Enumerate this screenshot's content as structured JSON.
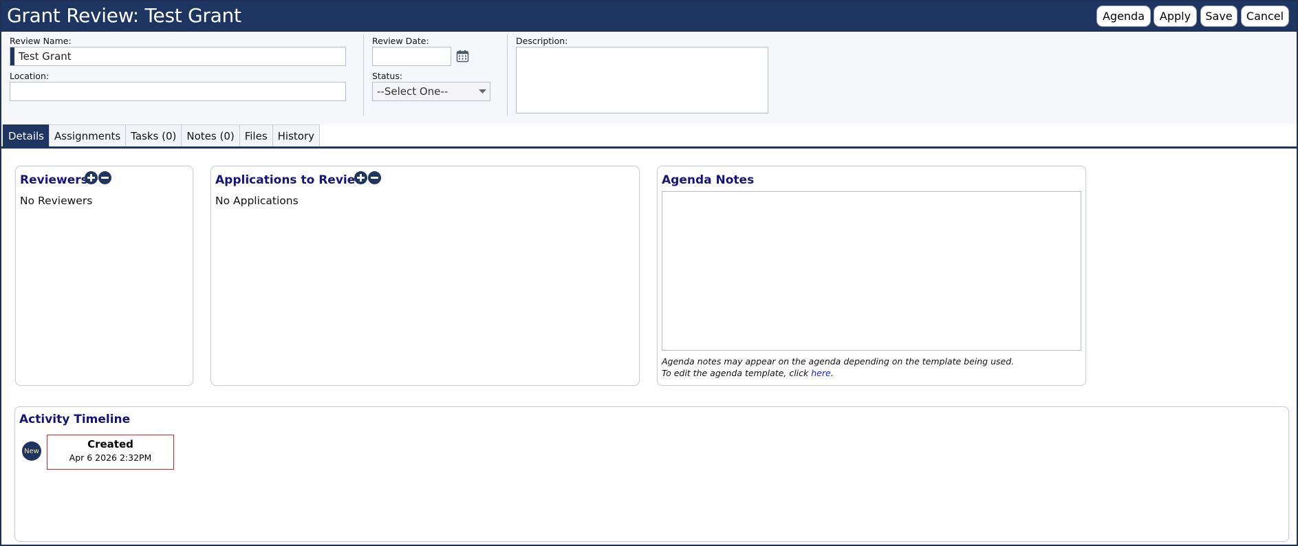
{
  "window": {
    "title": "Grant Review: Test Grant"
  },
  "toolbar": {
    "agenda_label": "Agenda",
    "apply_label": "Apply",
    "save_label": "Save",
    "cancel_label": "Cancel"
  },
  "form": {
    "review_name_label": "Review Name:",
    "review_name_value": "Test Grant",
    "location_label": "Location:",
    "location_value": "",
    "review_date_label": "Review Date:",
    "review_date_value": "",
    "status_label": "Status:",
    "status_value": "--Select One--",
    "description_label": "Description:",
    "description_value": ""
  },
  "tabs": [
    {
      "label": "Details",
      "active": true
    },
    {
      "label": "Assignments"
    },
    {
      "label": "Tasks (0)"
    },
    {
      "label": "Notes (0)"
    },
    {
      "label": "Files"
    },
    {
      "label": "History"
    }
  ],
  "reviewers": {
    "title": "Reviewers",
    "empty_text": "No Reviewers"
  },
  "applications": {
    "title": "Applications to Review",
    "empty_text": "No Applications"
  },
  "agenda_notes": {
    "title": "Agenda Notes",
    "hint_line1": "Agenda notes may appear on the agenda depending on the template being used.",
    "hint_line2_prefix": "To edit the agenda template, click ",
    "hint_link": "here",
    "hint_suffix": "."
  },
  "timeline": {
    "title": "Activity Timeline",
    "events": [
      {
        "badge": "New",
        "title": "Created",
        "date": "Apr 6 2026 2:32PM"
      }
    ]
  },
  "colors": {
    "brand": "#1f3561",
    "heading": "#15147a",
    "event_border": "#e02020",
    "link": "#1a1ae0"
  }
}
